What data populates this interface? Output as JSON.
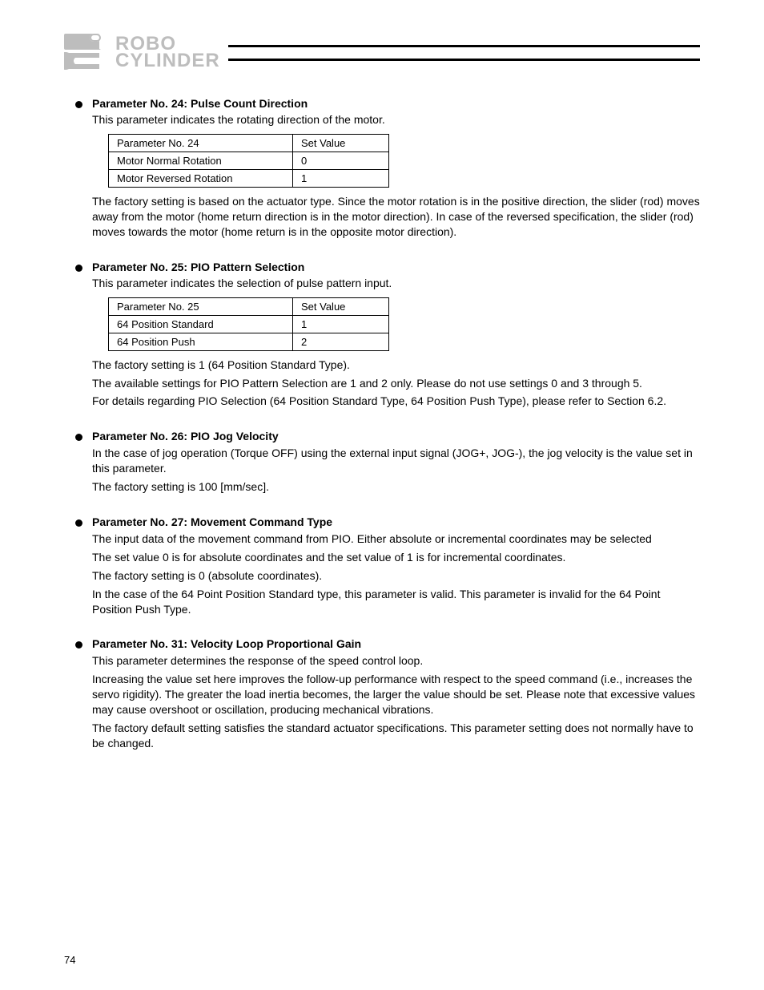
{
  "logo": {
    "top": "ROBO",
    "bottom": "CYLINDER"
  },
  "items": [
    {
      "title": "Parameter No. 24: Pulse Count Direction",
      "subtitle": "This parameter indicates the rotating direction of the motor.",
      "table": {
        "header": [
          "Parameter No. 24",
          "Set Value"
        ],
        "rows": [
          [
            "Motor Normal Rotation",
            "0"
          ],
          [
            "Motor Reversed Rotation",
            "1"
          ]
        ]
      },
      "body": [
        "The factory setting is based on the actuator type. Since the motor rotation is in the positive direction, the slider (rod) moves away from the motor (home return direction is in the motor direction). In case of the reversed specification, the slider (rod) moves towards the motor (home return is in the opposite motor direction)."
      ]
    },
    {
      "title": "Parameter No. 25: PIO Pattern Selection",
      "subtitle": "This parameter indicates the selection of pulse pattern input.",
      "table": {
        "header": [
          "Parameter No. 25",
          "Set Value"
        ],
        "rows": [
          [
            "64 Position Standard",
            "1"
          ],
          [
            "64 Position Push",
            "2"
          ]
        ]
      },
      "body": [
        "The factory setting is 1 (64 Position Standard Type).",
        "The available settings for PIO Pattern Selection are 1 and 2 only. Please do not use settings 0 and 3 through 5.",
        "For details regarding PIO Selection (64 Position Standard Type, 64 Position Push Type), please refer to Section 6.2."
      ]
    },
    {
      "title": "Parameter No. 26: PIO Jog Velocity",
      "body": [
        "In the case of jog operation (Torque OFF) using the external input signal (JOG+, JOG-), the jog velocity is the value set in this parameter.",
        "The factory setting is 100 [mm/sec]."
      ]
    },
    {
      "title": "Parameter No. 27: Movement Command Type",
      "body": [
        "The input data of the movement command from PIO. Either absolute or incremental coordinates may be selected",
        "The set value 0 is for absolute coordinates and the set value of 1 is for incremental coordinates.",
        "The factory setting is 0 (absolute coordinates).",
        "In the case of the 64 Point Position Standard type, this parameter is valid. This parameter is invalid for the 64 Point Position Push Type."
      ]
    },
    {
      "title": "Parameter No. 31: Velocity Loop Proportional Gain",
      "body": [
        "This parameter determines the response of the speed control loop.",
        "Increasing the value set here improves the follow-up performance with respect to the speed command (i.e., increases the servo rigidity). The greater the load inertia becomes, the larger the value should be set. Please note that excessive values may cause overshoot or oscillation, producing mechanical vibrations.",
        "The factory default setting satisfies the standard actuator specifications. This parameter setting does not normally have to be changed."
      ]
    }
  ],
  "page_number": "74"
}
